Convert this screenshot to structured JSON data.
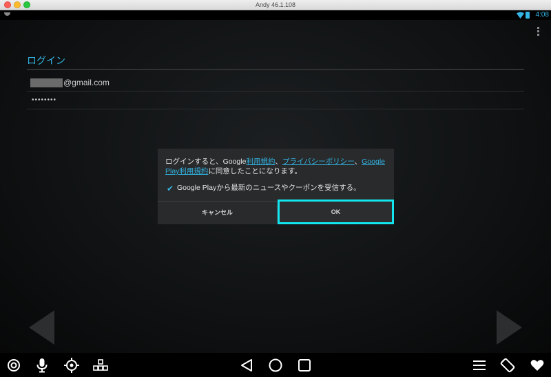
{
  "window": {
    "title": "Andy 46.1.108"
  },
  "status_bar": {
    "time": "4:08",
    "accent_color": "#33b5e5"
  },
  "login": {
    "title": "ログイン",
    "email_suffix": "@gmail.com",
    "password_mask": "••••••••"
  },
  "dialog": {
    "message_part1": "ログインすると、Google",
    "link_terms": "利用規約",
    "sep1": "、",
    "link_privacy": "プライバシーポリシー",
    "sep2": "、",
    "link_play_terms": "Google Play利用規約",
    "message_part2": "に同意したことになります。",
    "checkbox_label": "Google Playから最新のニュースやクーポンを受信する。",
    "checkbox_checked": true,
    "cancel_label": "キャンセル",
    "ok_label": "OK",
    "highlight_color": "#12e5ee"
  },
  "nav_icons": {
    "left": [
      "target-ring-icon",
      "microphone-icon",
      "crosshair-icon",
      "keyboard-keys-icon"
    ],
    "center": [
      "back-triangle-icon",
      "home-circle-icon",
      "recents-square-icon"
    ],
    "right": [
      "menu-icon",
      "rotate-screen-icon",
      "heart-icon"
    ]
  }
}
